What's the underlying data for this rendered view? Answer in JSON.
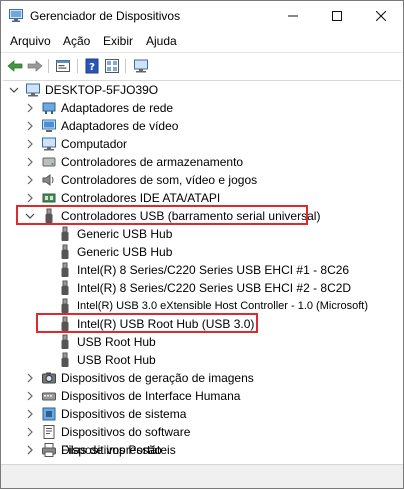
{
  "window": {
    "title": "Gerenciador de Dispositivos"
  },
  "menu": {
    "items": [
      "Arquivo",
      "Ação",
      "Exibir",
      "Ajuda"
    ]
  },
  "tree": {
    "root": "DESKTOP-5FJO39O",
    "categories": [
      "Adaptadores de rede",
      "Adaptadores de vídeo",
      "Computador",
      "Controladores de armazenamento",
      "Controladores de som, vídeo e jogos",
      "Controladores IDE ATA/ATAPI",
      "Controladores USB (barramento serial universal)",
      "Dispositivos de geração de imagens",
      "Dispositivos de Interface Humana",
      "Dispositivos de sistema",
      "Dispositivos do software",
      "Dispositivos Portáteis",
      "Filas de impressão"
    ],
    "usb_devices": [
      "Generic USB Hub",
      "Generic USB Hub",
      "Intel(R) 8 Series/C220 Series USB EHCI #1 - 8C26",
      "Intel(R) 8 Series/C220 Series USB EHCI #2 - 8C2D",
      "Intel(R) USB 3.0 eXtensible Host Controller - 1.0 (Microsoft)",
      "Intel(R) USB Root Hub (USB 3.0)",
      "USB Root Hub",
      "USB Root Hub"
    ]
  },
  "colors": {
    "highlight": "#e0282f",
    "accent": "#1e73c9"
  }
}
